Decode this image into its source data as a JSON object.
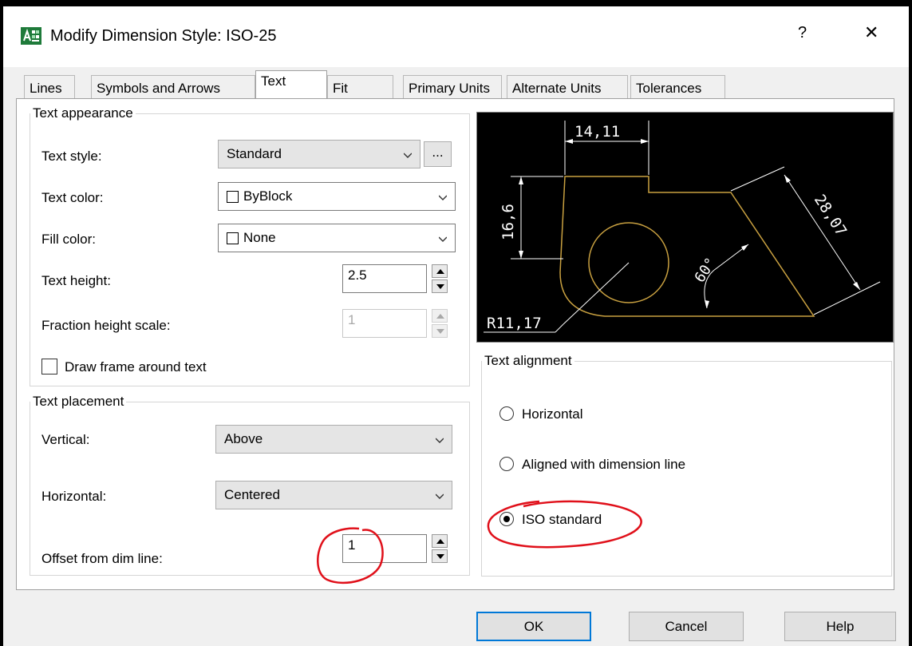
{
  "window": {
    "title": "Modify Dimension Style: ISO-25",
    "help_glyph": "?",
    "close_glyph": "✕",
    "icon": "dimension-style-app-icon"
  },
  "tabs": [
    {
      "label": "Lines",
      "active": false
    },
    {
      "label": "Symbols and Arrows",
      "active": false
    },
    {
      "label": "Text",
      "active": true
    },
    {
      "label": "Fit",
      "active": false
    },
    {
      "label": "Primary Units",
      "active": false
    },
    {
      "label": "Alternate Units",
      "active": false
    },
    {
      "label": "Tolerances",
      "active": false
    }
  ],
  "text_appearance": {
    "legend": "Text appearance",
    "text_style_label": "Text style:",
    "text_style_value": "Standard",
    "browse_label": "...",
    "text_color_label": "Text color:",
    "text_color_value": "ByBlock",
    "fill_color_label": "Fill color:",
    "fill_color_value": "None",
    "text_height_label": "Text height:",
    "text_height_value": "2.5",
    "fraction_label": "Fraction height scale:",
    "fraction_value": "1",
    "frame_label": "Draw frame around text",
    "frame_checked": false
  },
  "text_placement": {
    "legend": "Text placement",
    "vertical_label": "Vertical:",
    "vertical_value": "Above",
    "horizontal_label": "Horizontal:",
    "horizontal_value": "Centered",
    "offset_label": "Offset from dim line:",
    "offset_value": "1"
  },
  "preview": {
    "dim_top": "14,11",
    "dim_left": "16,6",
    "dim_right": "28,07",
    "dim_angle": "60°",
    "dim_radius": "R11,17",
    "colors": {
      "background": "#000000",
      "dimension": "#ffffff",
      "geometry": "#c8a040"
    }
  },
  "text_alignment": {
    "legend": "Text alignment",
    "options": [
      {
        "label": "Horizontal",
        "selected": false
      },
      {
        "label": "Aligned with dimension line",
        "selected": false
      },
      {
        "label": "ISO standard",
        "selected": true
      }
    ]
  },
  "buttons": {
    "ok": "OK",
    "cancel": "Cancel",
    "help": "Help"
  },
  "annotations": {
    "color": "#e0101a"
  }
}
